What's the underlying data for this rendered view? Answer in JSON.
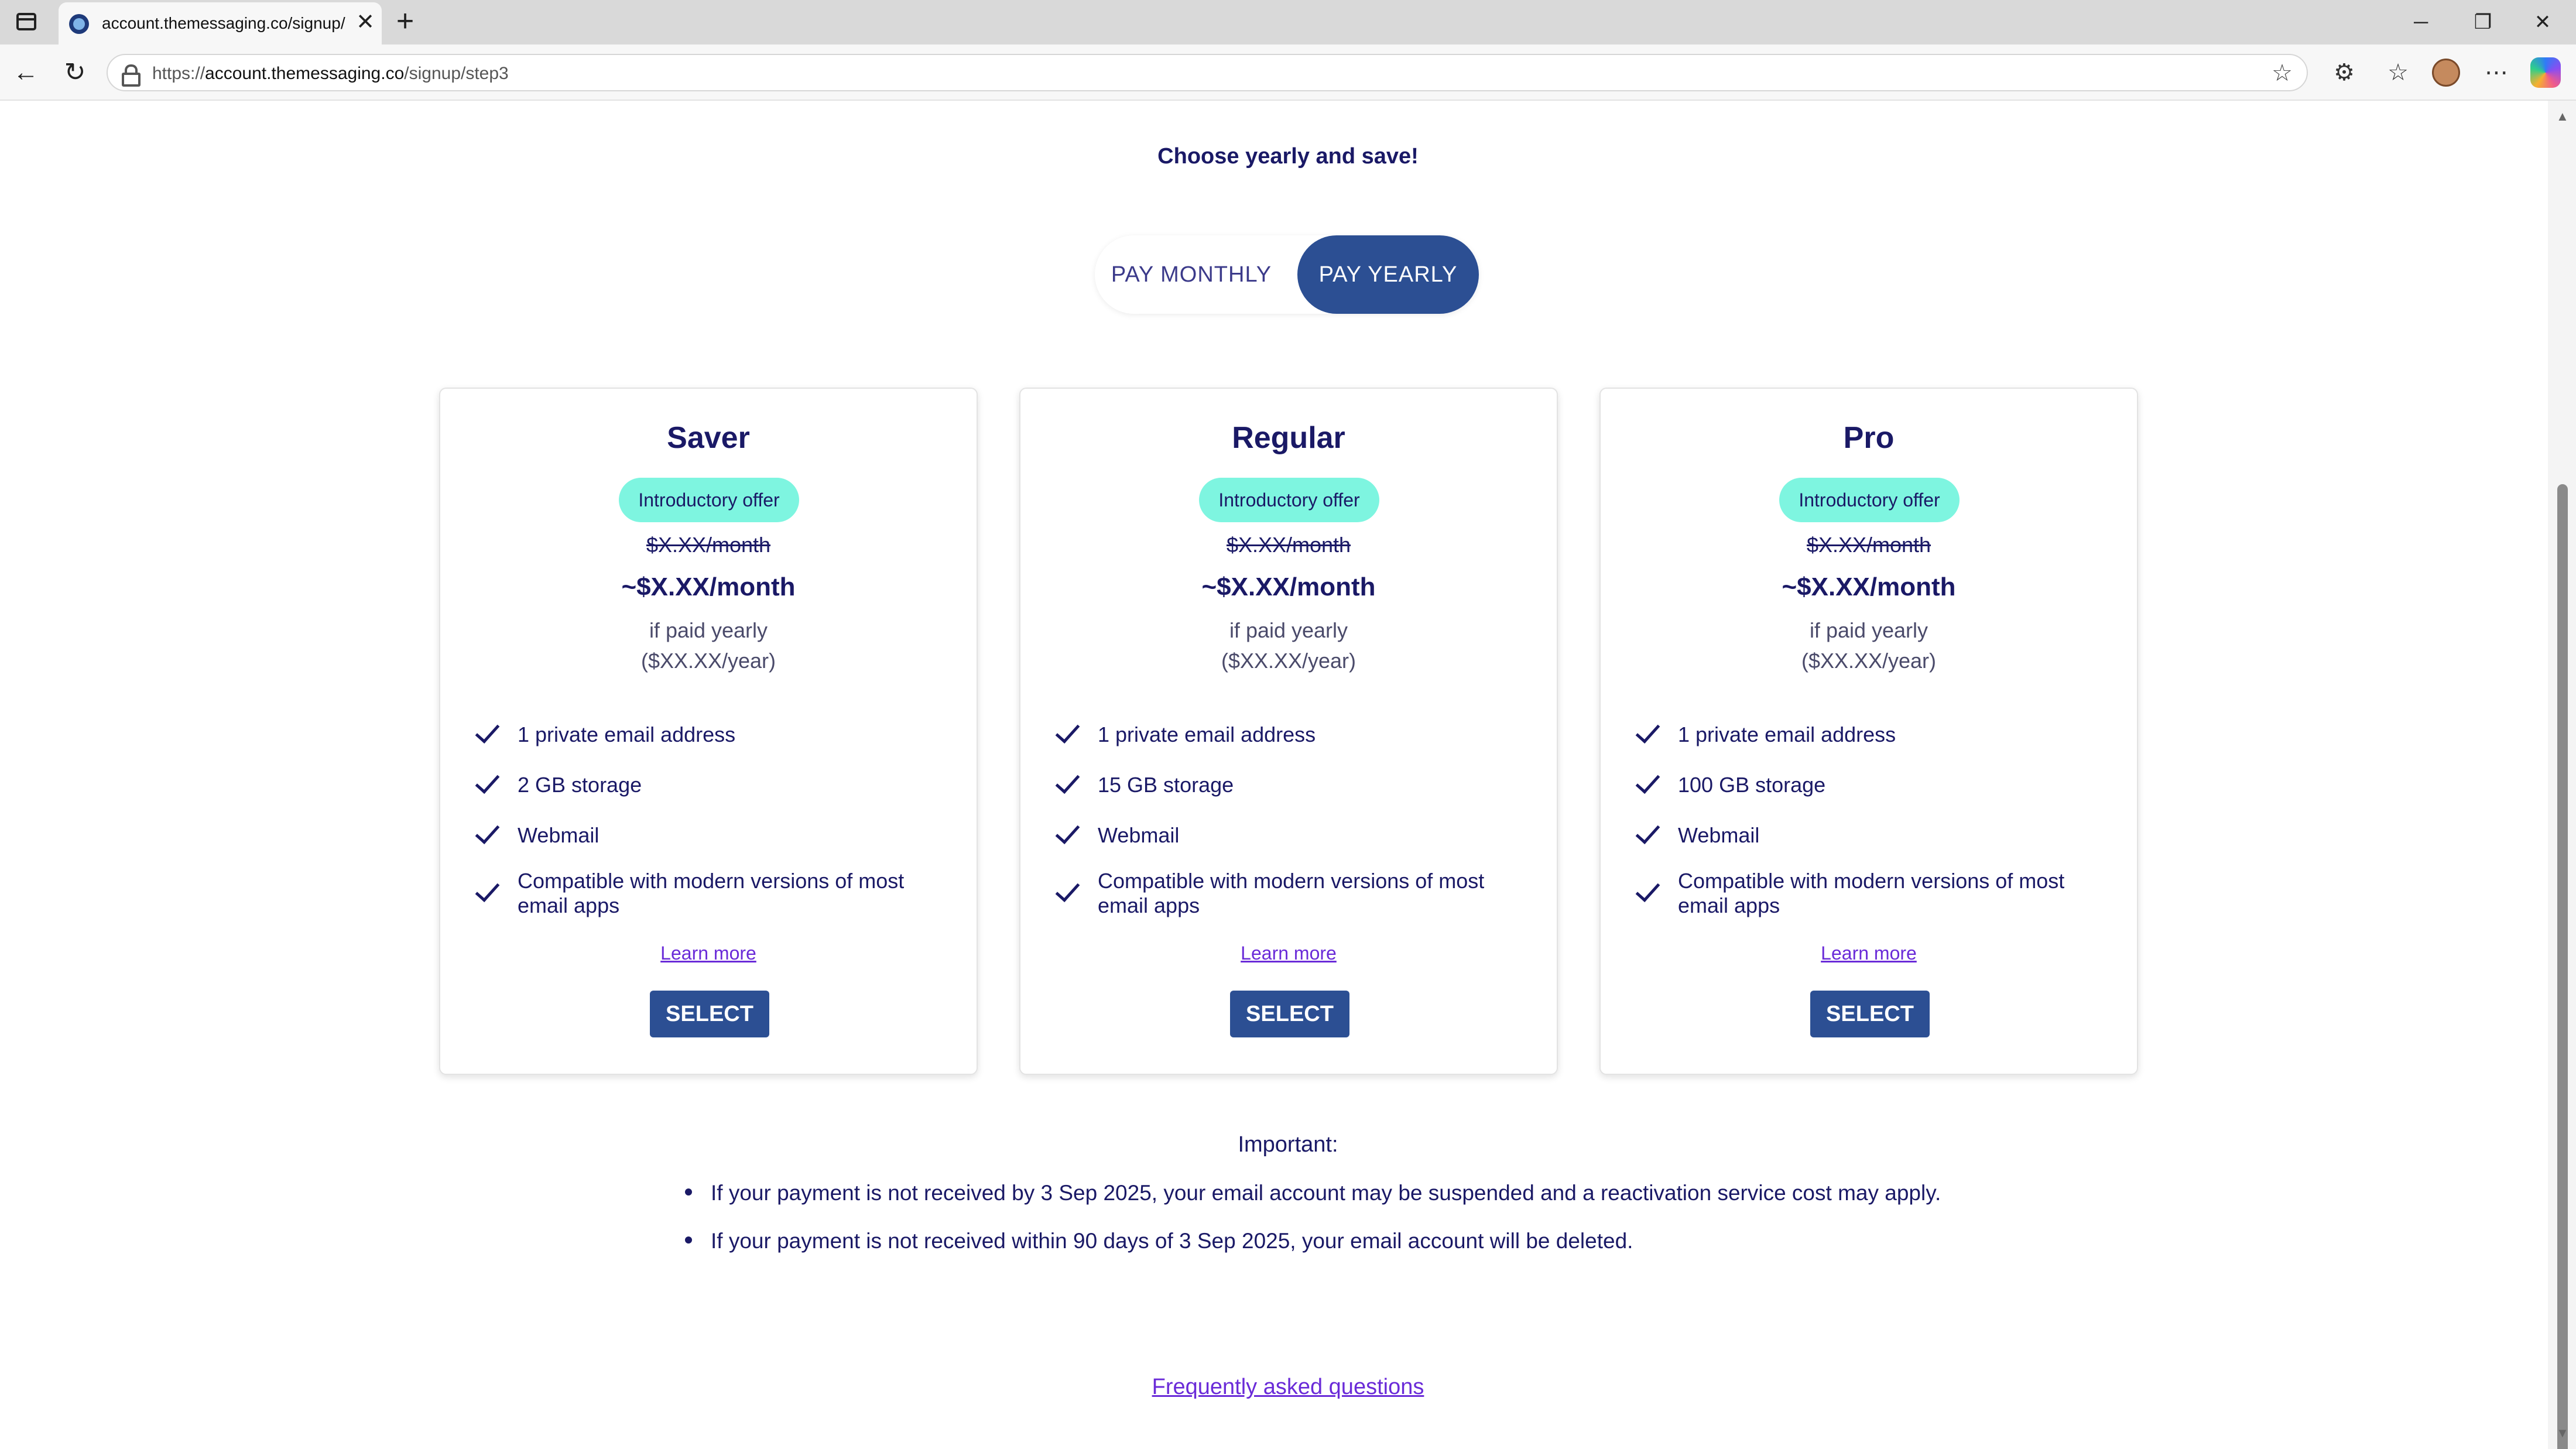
{
  "browser": {
    "tab_title": "account.themessaging.co/signup/",
    "url_prefix": "https://",
    "url_host": "account.themessaging.co",
    "url_path": "/signup/step3",
    "close_tab": "✕",
    "new_tab": "+",
    "minimize": "─",
    "restore": "❐",
    "close_window": "✕",
    "back": "←",
    "reload": "↻",
    "star": "☆",
    "extensions": "⚙",
    "favorites": "☆",
    "menu": "⋯"
  },
  "header": {
    "cut_text": "·  ·  ·  ·",
    "headline": "Choose yearly and save!"
  },
  "billing_toggle": {
    "monthly_label": "PAY MONTHLY",
    "yearly_label": "PAY YEARLY",
    "selected": "yearly"
  },
  "plans": [
    {
      "name": "Saver",
      "badge": "Introductory offer",
      "old_price": "$X.XX/month",
      "new_price": "~$X.XX/month",
      "paid_note": "if paid yearly",
      "year_price": "($XX.XX/year)",
      "features": [
        "1 private email address",
        "2 GB storage",
        "Webmail",
        "Compatible with modern versions of most email apps"
      ],
      "learn_more": "Learn more",
      "select_label": "SELECT"
    },
    {
      "name": "Regular",
      "badge": "Introductory offer",
      "old_price": "$X.XX/month",
      "new_price": "~$X.XX/month",
      "paid_note": "if paid yearly",
      "year_price": "($XX.XX/year)",
      "features": [
        "1 private email address",
        "15 GB storage",
        "Webmail",
        "Compatible with modern versions of most email apps"
      ],
      "learn_more": "Learn more",
      "select_label": "SELECT"
    },
    {
      "name": "Pro",
      "badge": "Introductory offer",
      "old_price": "$X.XX/month",
      "new_price": "~$X.XX/month",
      "paid_note": "if paid yearly",
      "year_price": "($XX.XX/year)",
      "features": [
        "1 private email address",
        "100 GB storage",
        "Webmail",
        "Compatible with modern versions of most email apps"
      ],
      "learn_more": "Learn more",
      "select_label": "SELECT"
    }
  ],
  "important": {
    "title": "Important:",
    "items": [
      "If your payment is not received by 3 Sep 2025, your email account may be suspended and a reactivation service cost may apply.",
      "If your payment is not received within 90 days of 3 Sep 2025, your email account will be deleted."
    ]
  },
  "faq_link": "Frequently asked questions",
  "colors": {
    "primary": "#2c4f93",
    "text": "#1a1966",
    "badge": "#7ef5e0",
    "link": "#6a2bd8"
  }
}
